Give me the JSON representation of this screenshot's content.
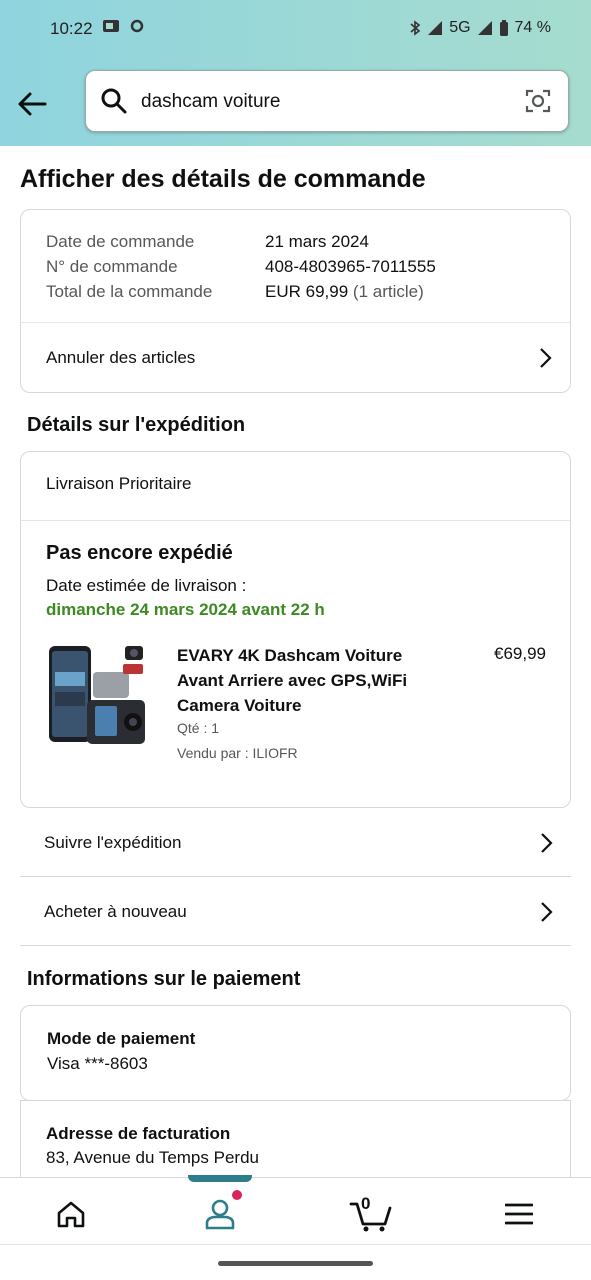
{
  "status_bar": {
    "time": "10:22",
    "network": "5G",
    "battery": "74 %"
  },
  "search": {
    "query": "dashcam voiture"
  },
  "page": {
    "title": "Afficher des détails de commande"
  },
  "order_summary": {
    "rows": [
      {
        "label": "Date de commande",
        "value": "21 mars 2024"
      },
      {
        "label": "N° de commande",
        "value": "408-4803965-7011555"
      },
      {
        "label": "Total de la commande",
        "value": "EUR 69,99",
        "suffix": "(1 article)"
      }
    ],
    "cancel_label": "Annuler des articles"
  },
  "shipping": {
    "section_title": "Détails sur l'expédition",
    "method": "Livraison Prioritaire",
    "status": "Pas encore expédié",
    "estimate_label": "Date estimée de livraison :",
    "estimate_date": "dimanche 24 mars 2024 avant 22 h",
    "item": {
      "title": "EVARY 4K Dashcam Voiture Avant Arriere avec GPS,WiFi Camera Voiture",
      "price": "€69,99",
      "qty": "Qté : 1",
      "seller": "Vendu par : ILIOFR"
    }
  },
  "actions": {
    "track": "Suivre l'expédition",
    "buy_again": "Acheter à nouveau"
  },
  "payment": {
    "section_title": "Informations sur le paiement",
    "method_title": "Mode de paiement",
    "method_value": "Visa  ***-8603",
    "billing_title": "Adresse de facturation",
    "billing_line1": "83, Avenue du Temps Perdu"
  },
  "bottom_nav": {
    "cart_count": "0"
  },
  "colors": {
    "header_gradient_start": "#8fd4de",
    "header_gradient_end": "#a6dccf",
    "delivery_green": "#3d8a22",
    "active_tab": "#2d7d8a",
    "notification_dot": "#d9245b"
  }
}
